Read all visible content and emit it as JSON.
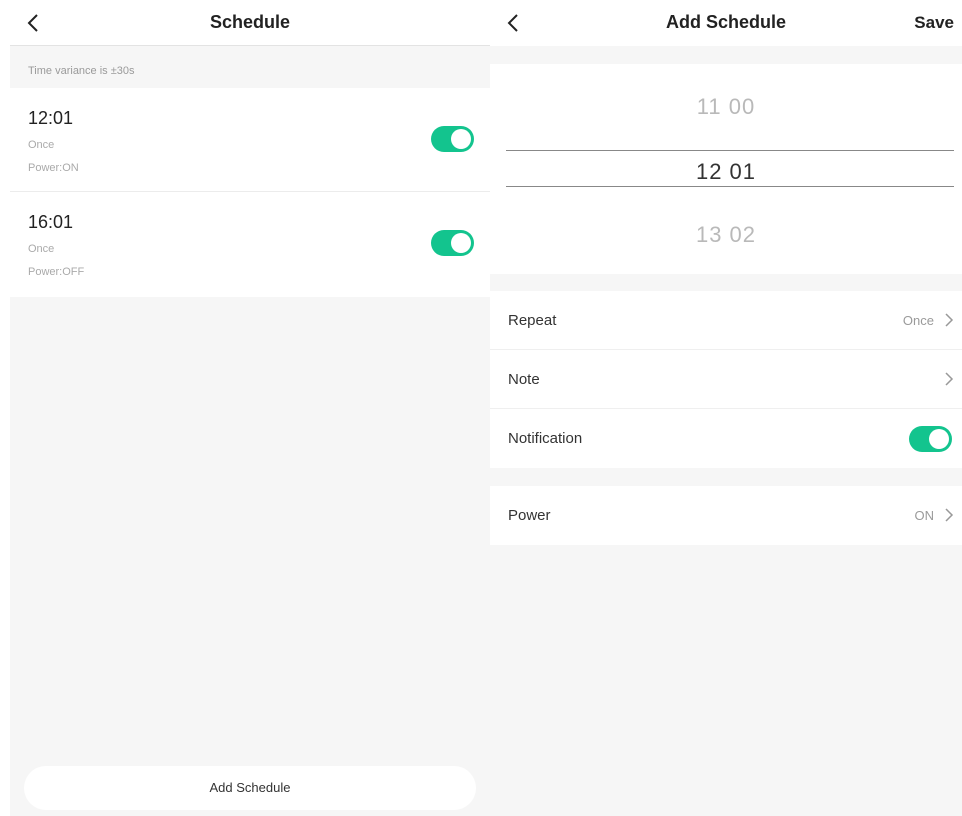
{
  "left_screen": {
    "title": "Schedule",
    "hint": "Time variance is ±30s",
    "schedules": [
      {
        "time": "12:01",
        "repeat": "Once",
        "power": "Power:ON",
        "enabled": true
      },
      {
        "time": "16:01",
        "repeat": "Once",
        "power": "Power:OFF",
        "enabled": true
      }
    ],
    "add_button_label": "Add Schedule"
  },
  "right_screen": {
    "title": "Add Schedule",
    "save_label": "Save",
    "picker": {
      "above": "11  00",
      "selected": "12  01",
      "below": "13  02"
    },
    "settings": {
      "repeat_label": "Repeat",
      "repeat_value": "Once",
      "note_label": "Note",
      "notification_label": "Notification",
      "notification_enabled": true,
      "power_label": "Power",
      "power_value": "ON"
    }
  },
  "colors": {
    "accent": "#13c48e",
    "background": "#f6f6f6"
  }
}
